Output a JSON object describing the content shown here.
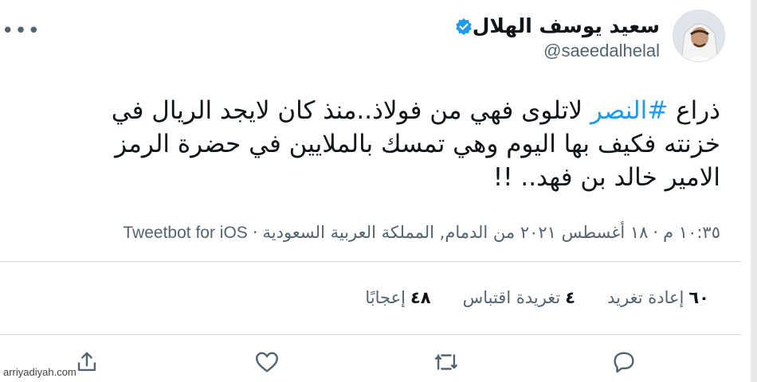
{
  "user": {
    "display_name": "سعيد يوسف الهلال",
    "handle": "@saeedalhelal"
  },
  "tweet": {
    "line1_prefix": "ذراع ",
    "hashtag": "#النصر",
    "line1_suffix": " لاتلوى فهي من فولاذ..منذ كان لايجد الريال في",
    "line2": "خزنته فكيف بها اليوم وهي تمسك بالملايين في حضرة الرمز",
    "line3": "الامير خالد بن فهد.. !!"
  },
  "meta": {
    "time": "١٠:٣٥ م",
    "date": "١٨ أغسطس ٢٠٢١",
    "location": "من الدمام, المملكة العربية السعودية",
    "source": "Tweetbot for iOS",
    "separator": "·"
  },
  "stats": {
    "retweets_count": "٦٠",
    "retweets_label": "إعادة تغريد",
    "quotes_count": "٤",
    "quotes_label": "تغريدة اقتباس",
    "likes_count": "٤٨",
    "likes_label": "إعجابًا"
  },
  "actions": {
    "reply_icon": "speech-bubble",
    "retweet_icon": "retweet-arrows",
    "like_icon": "heart-outline",
    "share_icon": "share-arrow"
  },
  "watermark": "arriyadiyah.com",
  "colors": {
    "accent": "#1d9bf0",
    "text": "#0f1419",
    "muted": "#536471",
    "divider": "#cfd9de"
  }
}
